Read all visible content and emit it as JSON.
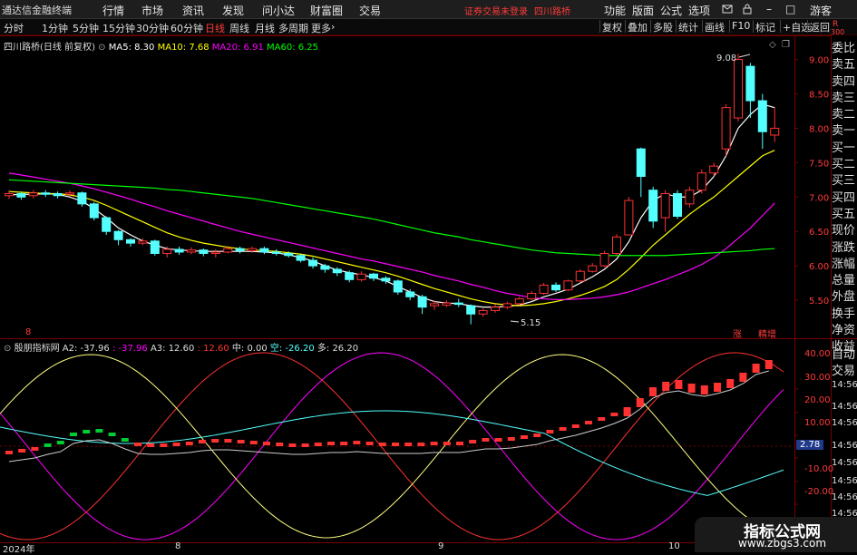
{
  "menubar": {
    "app_title": "通达信金融终端",
    "menus": [
      "行情",
      "市场",
      "资讯",
      "发现",
      "问小达",
      "财富圈",
      "交易"
    ],
    "notice": "证券交易未登录",
    "stock_link": "四川路桥",
    "right_menus": [
      "功能",
      "版面",
      "公式",
      "选项"
    ],
    "user": "游客"
  },
  "toolbar": {
    "periods": [
      "分时",
      "1分钟",
      "5分钟",
      "15分钟",
      "30分钟",
      "60分钟",
      "日线",
      "周线",
      "月线",
      "多周期",
      "更多"
    ],
    "active_period": "日线",
    "right_buttons": [
      "复权",
      "叠加",
      "多股",
      "统计",
      "画线",
      "F10",
      "标记",
      "+自选",
      "返回"
    ]
  },
  "main_legend": {
    "title": "四川路桥(日线 前复权)",
    "ma5": "MA5: 8.30",
    "ma10": "MA10: 7.68",
    "ma20": "MA20: 6.91",
    "ma60": "MA60: 6.25"
  },
  "price_axis": {
    "ticks": [
      "9.00",
      "8.50",
      "8.00",
      "7.50",
      "7.00",
      "6.50",
      "6.00",
      "5.50"
    ],
    "high_label": "9.08",
    "low_label": "5.15",
    "badge_up": "涨",
    "badge_fine": "精增",
    "corner_r": "R",
    "corner_300": "300",
    "left_marker": "8"
  },
  "sub_legend": {
    "title": "殷朋指标网",
    "a2": "A2: -37.96",
    "a2b": ": -37.96",
    "a3": "A3: 12.60",
    "a3b": ": 12.60",
    "mid": "中: 0.00",
    "kong": "空: -26.20",
    "duo": "多: 26.20"
  },
  "sub_axis": {
    "ticks": [
      "40.00",
      "30.00",
      "20.00",
      "10.00",
      "",
      "-10.00",
      "-20.00"
    ],
    "current": "2.78",
    "time_labels": [
      "14:56",
      "14:56",
      "14:56",
      "14:56",
      "14:56",
      "14:56",
      "14:56",
      "14:56"
    ]
  },
  "date_axis": [
    "2024年",
    "8",
    "9",
    "10"
  ],
  "sidebar_top": [
    "委比",
    "卖五",
    "卖四",
    "卖三",
    "卖二",
    "卖一",
    "买一",
    "买二",
    "买三",
    "买四",
    "买五",
    "现价",
    "涨跌",
    "涨幅",
    "总量",
    "外盘",
    "换手",
    "净资",
    "收益"
  ],
  "sidebar_bottom": [
    "自动",
    "交易"
  ],
  "watermark": {
    "line1": "指标公式网",
    "line2": "www.zbgs3.com"
  },
  "colors": {
    "ma5": "#ffffff",
    "ma10": "#ffff00",
    "ma20": "#ff00ff",
    "ma60": "#00ff00",
    "up": "#ff3232",
    "down": "#54ffff",
    "frame": "#7a0000"
  },
  "chart_data": {
    "type": "candlestick",
    "title": "四川路桥(日线 前复权)",
    "price_range": [
      5.0,
      9.35
    ],
    "candles": [
      {
        "o": 7.02,
        "c": 7.05,
        "h": 7.1,
        "l": 6.97
      },
      {
        "o": 7.05,
        "c": 7.0,
        "h": 7.08,
        "l": 6.96
      },
      {
        "o": 7.02,
        "c": 7.06,
        "h": 7.1,
        "l": 6.98
      },
      {
        "o": 7.06,
        "c": 7.04,
        "h": 7.1,
        "l": 7.0
      },
      {
        "o": 7.05,
        "c": 7.02,
        "h": 7.08,
        "l": 6.98
      },
      {
        "o": 7.04,
        "c": 7.06,
        "h": 7.1,
        "l": 7.01
      },
      {
        "o": 7.06,
        "c": 6.9,
        "h": 7.08,
        "l": 6.86
      },
      {
        "o": 6.9,
        "c": 6.7,
        "h": 6.93,
        "l": 6.66
      },
      {
        "o": 6.7,
        "c": 6.5,
        "h": 6.72,
        "l": 6.45
      },
      {
        "o": 6.5,
        "c": 6.38,
        "h": 6.52,
        "l": 6.3
      },
      {
        "o": 6.38,
        "c": 6.33,
        "h": 6.4,
        "l": 6.28
      },
      {
        "o": 6.33,
        "c": 6.36,
        "h": 6.4,
        "l": 6.3
      },
      {
        "o": 6.36,
        "c": 6.18,
        "h": 6.38,
        "l": 6.15
      },
      {
        "o": 6.18,
        "c": 6.24,
        "h": 6.28,
        "l": 6.12
      },
      {
        "o": 6.24,
        "c": 6.2,
        "h": 6.28,
        "l": 6.16
      },
      {
        "o": 6.2,
        "c": 6.23,
        "h": 6.27,
        "l": 6.17
      },
      {
        "o": 6.23,
        "c": 6.18,
        "h": 6.25,
        "l": 6.14
      },
      {
        "o": 6.18,
        "c": 6.2,
        "h": 6.24,
        "l": 6.12
      },
      {
        "o": 6.2,
        "c": 6.25,
        "h": 6.29,
        "l": 6.18
      },
      {
        "o": 6.25,
        "c": 6.22,
        "h": 6.28,
        "l": 6.18
      },
      {
        "o": 6.22,
        "c": 6.25,
        "h": 6.28,
        "l": 6.19
      },
      {
        "o": 6.25,
        "c": 6.2,
        "h": 6.28,
        "l": 6.17
      },
      {
        "o": 6.2,
        "c": 6.18,
        "h": 6.24,
        "l": 6.15
      },
      {
        "o": 6.18,
        "c": 6.15,
        "h": 6.21,
        "l": 6.12
      },
      {
        "o": 6.15,
        "c": 6.08,
        "h": 6.17,
        "l": 6.05
      },
      {
        "o": 6.08,
        "c": 6.0,
        "h": 6.12,
        "l": 5.96
      },
      {
        "o": 6.0,
        "c": 5.95,
        "h": 6.03,
        "l": 5.9
      },
      {
        "o": 5.95,
        "c": 5.9,
        "h": 5.98,
        "l": 5.85
      },
      {
        "o": 5.9,
        "c": 5.8,
        "h": 5.93,
        "l": 5.76
      },
      {
        "o": 5.8,
        "c": 5.88,
        "h": 5.92,
        "l": 5.77
      },
      {
        "o": 5.88,
        "c": 5.82,
        "h": 5.9,
        "l": 5.78
      },
      {
        "o": 5.82,
        "c": 5.78,
        "h": 5.85,
        "l": 5.74
      },
      {
        "o": 5.78,
        "c": 5.62,
        "h": 5.8,
        "l": 5.58
      },
      {
        "o": 5.62,
        "c": 5.55,
        "h": 5.66,
        "l": 5.5
      },
      {
        "o": 5.55,
        "c": 5.4,
        "h": 5.58,
        "l": 5.3
      },
      {
        "o": 5.42,
        "c": 5.45,
        "h": 5.5,
        "l": 5.36
      },
      {
        "o": 5.43,
        "c": 5.46,
        "h": 5.5,
        "l": 5.4
      },
      {
        "o": 5.46,
        "c": 5.44,
        "h": 5.52,
        "l": 5.4
      },
      {
        "o": 5.42,
        "c": 5.3,
        "h": 5.44,
        "l": 5.15
      },
      {
        "o": 5.3,
        "c": 5.35,
        "h": 5.38,
        "l": 5.26
      },
      {
        "o": 5.35,
        "c": 5.4,
        "h": 5.44,
        "l": 5.32
      },
      {
        "o": 5.4,
        "c": 5.45,
        "h": 5.48,
        "l": 5.37
      },
      {
        "o": 5.45,
        "c": 5.52,
        "h": 5.55,
        "l": 5.42
      },
      {
        "o": 5.52,
        "c": 5.6,
        "h": 5.63,
        "l": 5.5
      },
      {
        "o": 5.6,
        "c": 5.72,
        "h": 5.75,
        "l": 5.58
      },
      {
        "o": 5.72,
        "c": 5.65,
        "h": 5.76,
        "l": 5.62
      },
      {
        "o": 5.65,
        "c": 5.78,
        "h": 5.8,
        "l": 5.63
      },
      {
        "o": 5.78,
        "c": 5.92,
        "h": 5.95,
        "l": 5.76
      },
      {
        "o": 5.92,
        "c": 6.0,
        "h": 6.04,
        "l": 5.9
      },
      {
        "o": 6.0,
        "c": 6.18,
        "h": 6.22,
        "l": 5.98
      },
      {
        "o": 6.18,
        "c": 6.42,
        "h": 6.46,
        "l": 6.15
      },
      {
        "o": 6.45,
        "c": 6.95,
        "h": 7.0,
        "l": 6.44
      },
      {
        "o": 7.7,
        "c": 7.3,
        "h": 7.72,
        "l": 7.0
      },
      {
        "o": 7.1,
        "c": 6.65,
        "h": 7.15,
        "l": 6.55
      },
      {
        "o": 6.7,
        "c": 7.05,
        "h": 7.1,
        "l": 6.5
      },
      {
        "o": 7.05,
        "c": 6.72,
        "h": 7.1,
        "l": 6.68
      },
      {
        "o": 6.9,
        "c": 7.1,
        "h": 7.15,
        "l": 6.85
      },
      {
        "o": 7.1,
        "c": 7.35,
        "h": 7.4,
        "l": 7.05
      },
      {
        "o": 7.35,
        "c": 7.45,
        "h": 7.5,
        "l": 7.3
      },
      {
        "o": 7.7,
        "c": 8.3,
        "h": 8.35,
        "l": 7.6
      },
      {
        "o": 8.15,
        "c": 9.0,
        "h": 9.08,
        "l": 8.1
      },
      {
        "o": 8.9,
        "c": 8.4,
        "h": 8.95,
        "l": 8.15
      },
      {
        "o": 8.4,
        "c": 7.95,
        "h": 8.5,
        "l": 7.7
      },
      {
        "o": 7.9,
        "c": 8.0,
        "h": 8.3,
        "l": 7.8
      }
    ],
    "series": [
      {
        "name": "MA5",
        "values": [
          7.03,
          7.04,
          7.04,
          7.05,
          7.04,
          7.0,
          6.94,
          6.83,
          6.7,
          6.55,
          6.45,
          6.36,
          6.3,
          6.25,
          6.23,
          6.22,
          6.21,
          6.21,
          6.21,
          6.21,
          6.21,
          6.2,
          6.19,
          6.16,
          6.12,
          6.07,
          6.0,
          5.94,
          5.9,
          5.87,
          5.83,
          5.78,
          5.7,
          5.62,
          5.54,
          5.48,
          5.46,
          5.45,
          5.42,
          5.4,
          5.4,
          5.41,
          5.43,
          5.48,
          5.55,
          5.6,
          5.66,
          5.75,
          5.84,
          5.95,
          6.1,
          6.35,
          6.7,
          6.95,
          7.05,
          7.0,
          7.0,
          7.1,
          7.3,
          7.6,
          8.0,
          8.2,
          8.35,
          8.3
        ]
      },
      {
        "name": "MA10",
        "values": [
          7.08,
          7.07,
          7.06,
          7.05,
          7.05,
          7.03,
          7.0,
          6.95,
          6.88,
          6.8,
          6.72,
          6.64,
          6.56,
          6.48,
          6.42,
          6.37,
          6.33,
          6.3,
          6.27,
          6.25,
          6.23,
          6.22,
          6.21,
          6.19,
          6.17,
          6.14,
          6.1,
          6.06,
          6.02,
          5.98,
          5.94,
          5.9,
          5.85,
          5.79,
          5.73,
          5.67,
          5.62,
          5.57,
          5.52,
          5.48,
          5.45,
          5.43,
          5.42,
          5.43,
          5.45,
          5.48,
          5.52,
          5.57,
          5.63,
          5.7,
          5.8,
          5.95,
          6.12,
          6.3,
          6.45,
          6.6,
          6.75,
          6.88,
          7.0,
          7.15,
          7.3,
          7.45,
          7.6,
          7.68
        ]
      },
      {
        "name": "MA20",
        "values": [
          7.35,
          7.32,
          7.29,
          7.26,
          7.23,
          7.2,
          7.16,
          7.12,
          7.07,
          7.02,
          6.97,
          6.91,
          6.86,
          6.8,
          6.75,
          6.7,
          6.65,
          6.6,
          6.55,
          6.5,
          6.46,
          6.42,
          6.38,
          6.34,
          6.3,
          6.26,
          6.22,
          6.18,
          6.14,
          6.1,
          6.07,
          6.03,
          5.99,
          5.95,
          5.91,
          5.86,
          5.82,
          5.78,
          5.73,
          5.69,
          5.64,
          5.6,
          5.57,
          5.54,
          5.52,
          5.51,
          5.51,
          5.52,
          5.53,
          5.55,
          5.58,
          5.62,
          5.68,
          5.74,
          5.8,
          5.87,
          5.94,
          6.02,
          6.12,
          6.25,
          6.4,
          6.55,
          6.73,
          6.91
        ]
      },
      {
        "name": "MA60",
        "values": [
          7.25,
          7.24,
          7.23,
          7.22,
          7.21,
          7.2,
          7.19,
          7.18,
          7.17,
          7.16,
          7.15,
          7.14,
          7.13,
          7.11,
          7.1,
          7.08,
          7.06,
          7.04,
          7.02,
          7.0,
          6.98,
          6.95,
          6.92,
          6.89,
          6.86,
          6.83,
          6.8,
          6.77,
          6.74,
          6.71,
          6.68,
          6.64,
          6.6,
          6.56,
          6.52,
          6.48,
          6.45,
          6.42,
          6.38,
          6.35,
          6.32,
          6.29,
          6.26,
          6.23,
          6.21,
          6.19,
          6.18,
          6.17,
          6.16,
          6.15,
          6.15,
          6.15,
          6.15,
          6.15,
          6.15,
          6.16,
          6.17,
          6.18,
          6.19,
          6.2,
          6.21,
          6.22,
          6.24,
          6.25
        ]
      }
    ]
  }
}
